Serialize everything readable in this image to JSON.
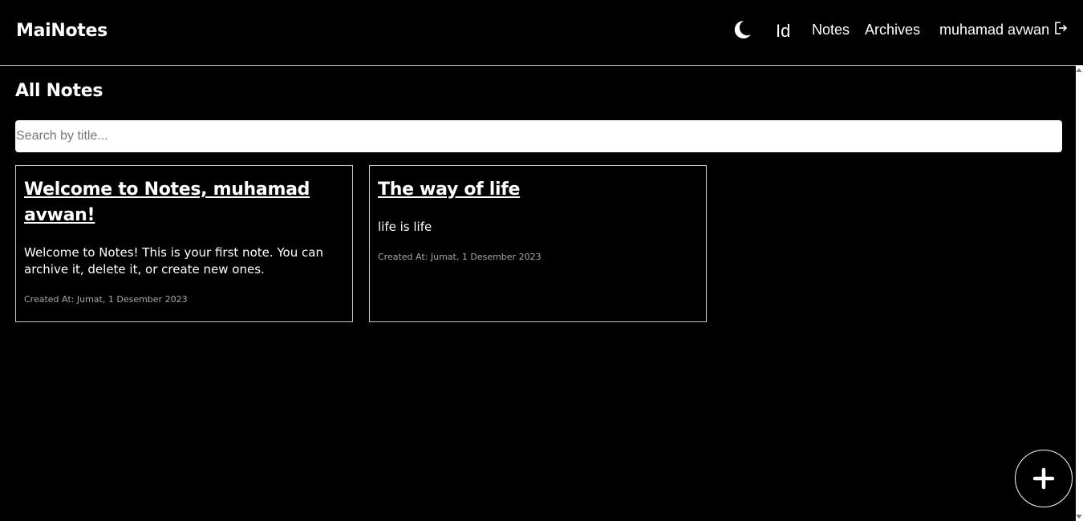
{
  "header": {
    "brand": "MaiNotes",
    "theme_icon": "moon-icon",
    "lang_toggle": "Id",
    "nav": {
      "notes": "Notes",
      "archives": "Archives"
    },
    "user_name": "muhamad avwan",
    "logout_icon": "logout-icon"
  },
  "main": {
    "title": "All Notes",
    "search": {
      "placeholder": "Search by title...",
      "value": ""
    },
    "notes": [
      {
        "title": "Welcome to Notes, muhamad avwan!",
        "body": "Welcome to Notes! This is your first note. You can archive it, delete it, or create new ones.",
        "created_at": "Created At: Jumat, 1 Desember 2023"
      },
      {
        "title": "The way of life",
        "body": "life is life",
        "created_at": "Created At: Jumat, 1 Desember 2023"
      }
    ],
    "add_icon": "plus-icon"
  },
  "colors": {
    "background": "#000000",
    "text": "#ffffff",
    "muted_text": "#a8a8a8",
    "border": "#c8c8c8"
  }
}
